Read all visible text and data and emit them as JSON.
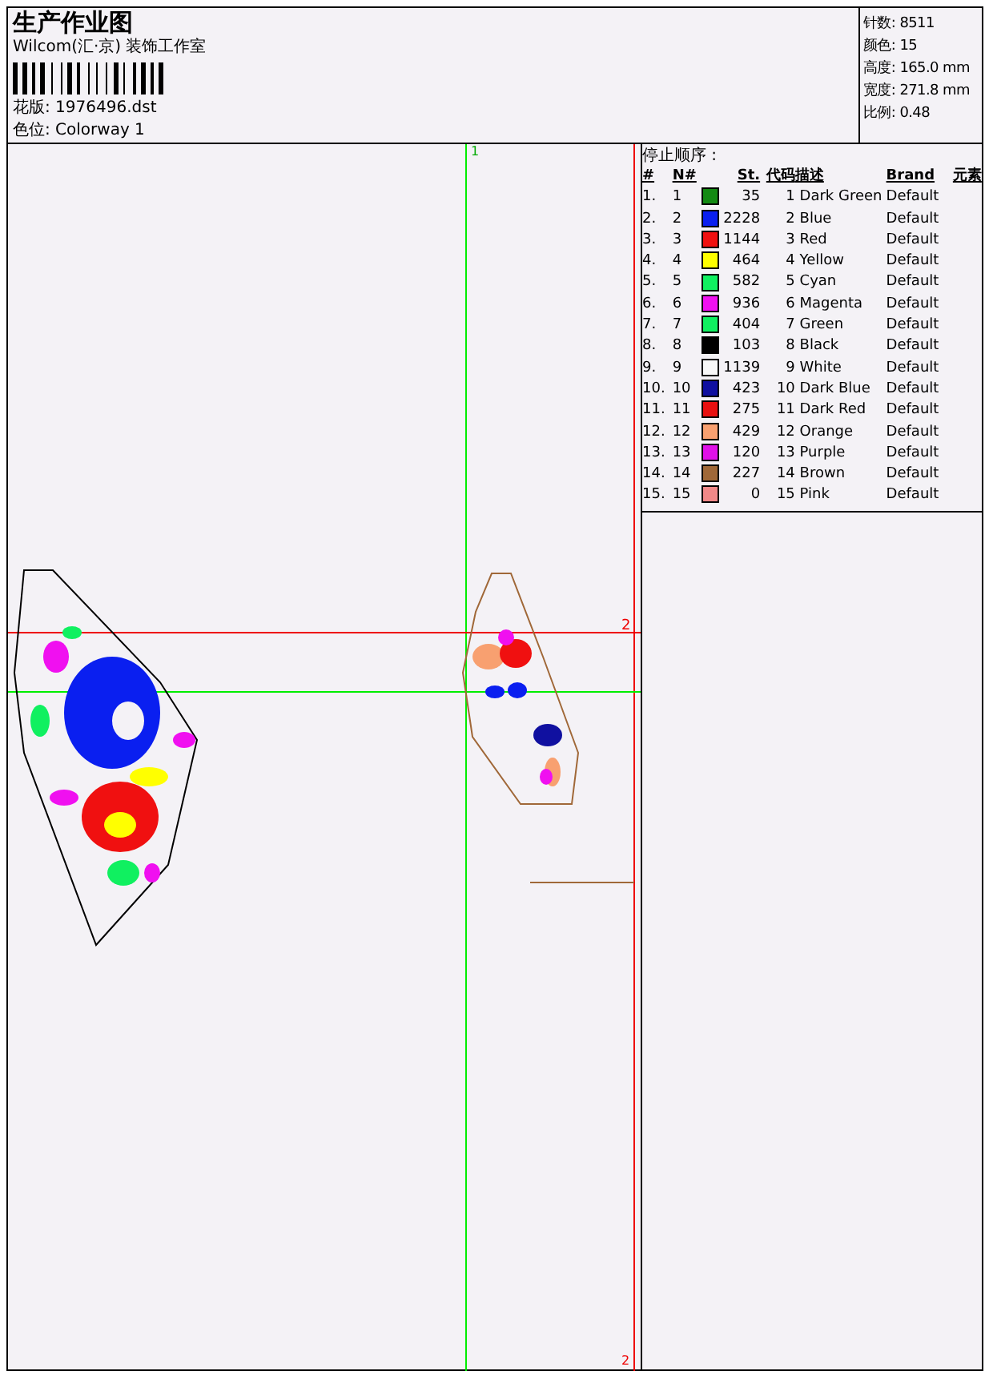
{
  "header": {
    "title": "生产作业图",
    "company": "Wilcom(汇·京) 装饰工作室",
    "design_file": "花版: 1976496.dst",
    "colorway": "色位: Colorway 1",
    "stats": [
      "针数: 8511",
      "颜色: 15",
      "高度: 165.0 mm",
      "宽度: 271.8 mm",
      "比例: 0.48"
    ]
  },
  "canvas": {
    "markers": [
      "1",
      "2",
      "2"
    ]
  },
  "stop_sequence": {
    "title": "停止顺序 :",
    "columns": [
      "#",
      "N#",
      "St.",
      "代码",
      "描述",
      "Brand",
      "元素"
    ],
    "rows": [
      {
        "index": "1.",
        "no": "1",
        "color": "#138a13",
        "stitches": "35",
        "code": "1",
        "description": "Dark Green",
        "brand": "Default"
      },
      {
        "index": "2.",
        "no": "2",
        "color": "#0a1ff0",
        "stitches": "2228",
        "code": "2",
        "description": "Blue",
        "brand": "Default"
      },
      {
        "index": "3.",
        "no": "3",
        "color": "#f01010",
        "stitches": "1144",
        "code": "3",
        "description": "Red",
        "brand": "Default"
      },
      {
        "index": "4.",
        "no": "4",
        "color": "#ffff00",
        "stitches": "464",
        "code": "4",
        "description": "Yellow",
        "brand": "Default"
      },
      {
        "index": "5.",
        "no": "5",
        "color": "#10f060",
        "stitches": "582",
        "code": "5",
        "description": "Cyan",
        "brand": "Default"
      },
      {
        "index": "6.",
        "no": "6",
        "color": "#f010f0",
        "stitches": "936",
        "code": "6",
        "description": "Magenta",
        "brand": "Default"
      },
      {
        "index": "7.",
        "no": "7",
        "color": "#10f060",
        "stitches": "404",
        "code": "7",
        "description": "Green",
        "brand": "Default"
      },
      {
        "index": "8.",
        "no": "8",
        "color": "#000000",
        "stitches": "103",
        "code": "8",
        "description": "Black",
        "brand": "Default"
      },
      {
        "index": "9.",
        "no": "9",
        "color": "#f8f8f8",
        "stitches": "1139",
        "code": "9",
        "description": "White",
        "brand": "Default"
      },
      {
        "index": "10.",
        "no": "10",
        "color": "#1010a0",
        "stitches": "423",
        "code": "10",
        "description": "Dark Blue",
        "brand": "Default"
      },
      {
        "index": "11.",
        "no": "11",
        "color": "#e81010",
        "stitches": "275",
        "code": "11",
        "description": "Dark Red",
        "brand": "Default"
      },
      {
        "index": "12.",
        "no": "12",
        "color": "#f8a070",
        "stitches": "429",
        "code": "12",
        "description": "Orange",
        "brand": "Default"
      },
      {
        "index": "13.",
        "no": "13",
        "color": "#e010e8",
        "stitches": "120",
        "code": "13",
        "description": "Purple",
        "brand": "Default"
      },
      {
        "index": "14.",
        "no": "14",
        "color": "#a06838",
        "stitches": "227",
        "code": "14",
        "description": "Brown",
        "brand": "Default"
      },
      {
        "index": "15.",
        "no": "15",
        "color": "#f08888",
        "stitches": "0",
        "code": "15",
        "description": "Pink",
        "brand": "Default"
      }
    ]
  }
}
